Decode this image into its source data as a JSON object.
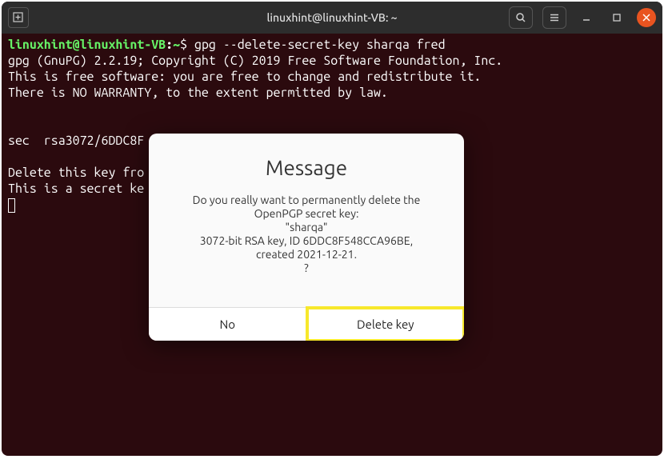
{
  "titlebar": {
    "title": "linuxhint@linuxhint-VB: ~"
  },
  "terminal": {
    "prompt_user": "linuxhint@linuxhint-VB",
    "prompt_sep": ":",
    "prompt_path": "~",
    "prompt_symbol": "$ ",
    "command": "gpg --delete-secret-key sharqa fred",
    "lines": [
      "gpg (GnuPG) 2.2.19; Copyright (C) 2019 Free Software Foundation, Inc.",
      "This is free software: you are free to change and redistribute it.",
      "There is NO WARRANTY, to the extent permitted by law.",
      "",
      "",
      "sec  rsa3072/6DDC8F",
      "",
      "Delete this key fro",
      "This is a secret ke"
    ]
  },
  "dialog": {
    "title": "Message",
    "text": "Do you really want to permanently delete the\nOpenPGP secret key:\n\"sharqa\"\n3072-bit RSA key, ID 6DDC8F548CCA96BE,\ncreated 2021-12-21.\n?",
    "no_label": "No",
    "delete_label": "Delete key"
  }
}
